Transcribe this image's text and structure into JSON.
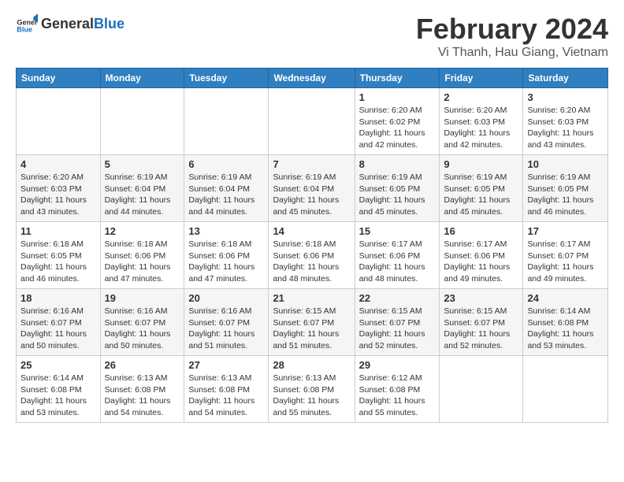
{
  "logo": {
    "general": "General",
    "blue": "Blue"
  },
  "header": {
    "title": "February 2024",
    "subtitle": "Vi Thanh, Hau Giang, Vietnam"
  },
  "columns": [
    "Sunday",
    "Monday",
    "Tuesday",
    "Wednesday",
    "Thursday",
    "Friday",
    "Saturday"
  ],
  "weeks": [
    [
      {
        "day": "",
        "info": ""
      },
      {
        "day": "",
        "info": ""
      },
      {
        "day": "",
        "info": ""
      },
      {
        "day": "",
        "info": ""
      },
      {
        "day": "1",
        "info": "Sunrise: 6:20 AM\nSunset: 6:02 PM\nDaylight: 11 hours and 42 minutes."
      },
      {
        "day": "2",
        "info": "Sunrise: 6:20 AM\nSunset: 6:03 PM\nDaylight: 11 hours and 42 minutes."
      },
      {
        "day": "3",
        "info": "Sunrise: 6:20 AM\nSunset: 6:03 PM\nDaylight: 11 hours and 43 minutes."
      }
    ],
    [
      {
        "day": "4",
        "info": "Sunrise: 6:20 AM\nSunset: 6:03 PM\nDaylight: 11 hours and 43 minutes."
      },
      {
        "day": "5",
        "info": "Sunrise: 6:19 AM\nSunset: 6:04 PM\nDaylight: 11 hours and 44 minutes."
      },
      {
        "day": "6",
        "info": "Sunrise: 6:19 AM\nSunset: 6:04 PM\nDaylight: 11 hours and 44 minutes."
      },
      {
        "day": "7",
        "info": "Sunrise: 6:19 AM\nSunset: 6:04 PM\nDaylight: 11 hours and 45 minutes."
      },
      {
        "day": "8",
        "info": "Sunrise: 6:19 AM\nSunset: 6:05 PM\nDaylight: 11 hours and 45 minutes."
      },
      {
        "day": "9",
        "info": "Sunrise: 6:19 AM\nSunset: 6:05 PM\nDaylight: 11 hours and 45 minutes."
      },
      {
        "day": "10",
        "info": "Sunrise: 6:19 AM\nSunset: 6:05 PM\nDaylight: 11 hours and 46 minutes."
      }
    ],
    [
      {
        "day": "11",
        "info": "Sunrise: 6:18 AM\nSunset: 6:05 PM\nDaylight: 11 hours and 46 minutes."
      },
      {
        "day": "12",
        "info": "Sunrise: 6:18 AM\nSunset: 6:06 PM\nDaylight: 11 hours and 47 minutes."
      },
      {
        "day": "13",
        "info": "Sunrise: 6:18 AM\nSunset: 6:06 PM\nDaylight: 11 hours and 47 minutes."
      },
      {
        "day": "14",
        "info": "Sunrise: 6:18 AM\nSunset: 6:06 PM\nDaylight: 11 hours and 48 minutes."
      },
      {
        "day": "15",
        "info": "Sunrise: 6:17 AM\nSunset: 6:06 PM\nDaylight: 11 hours and 48 minutes."
      },
      {
        "day": "16",
        "info": "Sunrise: 6:17 AM\nSunset: 6:06 PM\nDaylight: 11 hours and 49 minutes."
      },
      {
        "day": "17",
        "info": "Sunrise: 6:17 AM\nSunset: 6:07 PM\nDaylight: 11 hours and 49 minutes."
      }
    ],
    [
      {
        "day": "18",
        "info": "Sunrise: 6:16 AM\nSunset: 6:07 PM\nDaylight: 11 hours and 50 minutes."
      },
      {
        "day": "19",
        "info": "Sunrise: 6:16 AM\nSunset: 6:07 PM\nDaylight: 11 hours and 50 minutes."
      },
      {
        "day": "20",
        "info": "Sunrise: 6:16 AM\nSunset: 6:07 PM\nDaylight: 11 hours and 51 minutes."
      },
      {
        "day": "21",
        "info": "Sunrise: 6:15 AM\nSunset: 6:07 PM\nDaylight: 11 hours and 51 minutes."
      },
      {
        "day": "22",
        "info": "Sunrise: 6:15 AM\nSunset: 6:07 PM\nDaylight: 11 hours and 52 minutes."
      },
      {
        "day": "23",
        "info": "Sunrise: 6:15 AM\nSunset: 6:07 PM\nDaylight: 11 hours and 52 minutes."
      },
      {
        "day": "24",
        "info": "Sunrise: 6:14 AM\nSunset: 6:08 PM\nDaylight: 11 hours and 53 minutes."
      }
    ],
    [
      {
        "day": "25",
        "info": "Sunrise: 6:14 AM\nSunset: 6:08 PM\nDaylight: 11 hours and 53 minutes."
      },
      {
        "day": "26",
        "info": "Sunrise: 6:13 AM\nSunset: 6:08 PM\nDaylight: 11 hours and 54 minutes."
      },
      {
        "day": "27",
        "info": "Sunrise: 6:13 AM\nSunset: 6:08 PM\nDaylight: 11 hours and 54 minutes."
      },
      {
        "day": "28",
        "info": "Sunrise: 6:13 AM\nSunset: 6:08 PM\nDaylight: 11 hours and 55 minutes."
      },
      {
        "day": "29",
        "info": "Sunrise: 6:12 AM\nSunset: 6:08 PM\nDaylight: 11 hours and 55 minutes."
      },
      {
        "day": "",
        "info": ""
      },
      {
        "day": "",
        "info": ""
      }
    ]
  ]
}
